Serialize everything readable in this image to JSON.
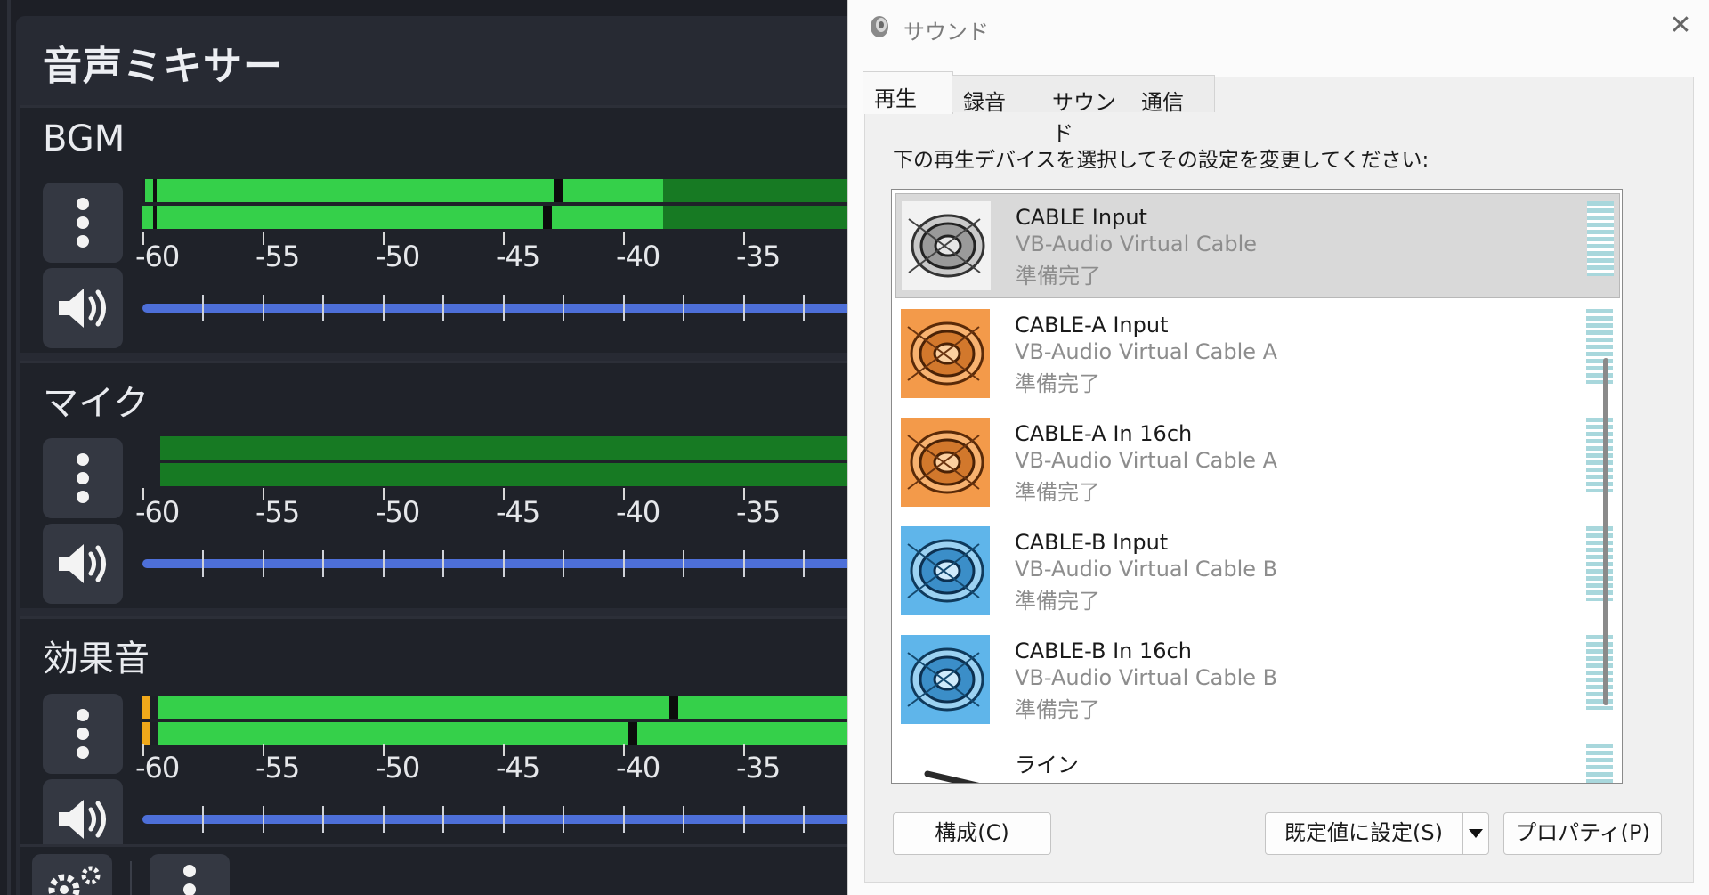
{
  "mixer": {
    "title": "音声ミキサー",
    "channels": [
      {
        "name": "BGM"
      },
      {
        "name": "マイク"
      },
      {
        "name": "効果音"
      }
    ],
    "scale_labels": [
      "-60",
      "-55",
      "-50",
      "-45",
      "-40",
      "-35"
    ],
    "colors": {
      "meter_green": "#35d04a",
      "meter_dark_green": "#177a23",
      "slider_blue": "#4d6fd8",
      "peak_yellow": "#f0a81a"
    }
  },
  "dialog": {
    "title": "サウンド",
    "tabs": [
      "再生",
      "録音",
      "サウンド",
      "通信"
    ],
    "instruction": "下の再生デバイスを選択してその設定を変更してください:",
    "devices": [
      {
        "name": "CABLE Input",
        "desc": "VB-Audio Virtual Cable",
        "status": "準備完了",
        "icon_color": "gray"
      },
      {
        "name": "CABLE-A Input",
        "desc": "VB-Audio Virtual Cable A",
        "status": "準備完了",
        "icon_color": "orange"
      },
      {
        "name": "CABLE-A In 16ch",
        "desc": "VB-Audio Virtual Cable A",
        "status": "準備完了",
        "icon_color": "orange"
      },
      {
        "name": "CABLE-B Input",
        "desc": "VB-Audio Virtual Cable B",
        "status": "準備完了",
        "icon_color": "blue"
      },
      {
        "name": "CABLE-B In 16ch",
        "desc": "VB-Audio Virtual Cable B",
        "status": "準備完了",
        "icon_color": "blue"
      },
      {
        "name": "ライン",
        "desc": "",
        "status": "",
        "icon_color": "dark"
      }
    ],
    "buttons": {
      "configure": "構成(C)",
      "set_default": "既定値に設定(S)",
      "properties": "プロパティ(P)"
    }
  }
}
